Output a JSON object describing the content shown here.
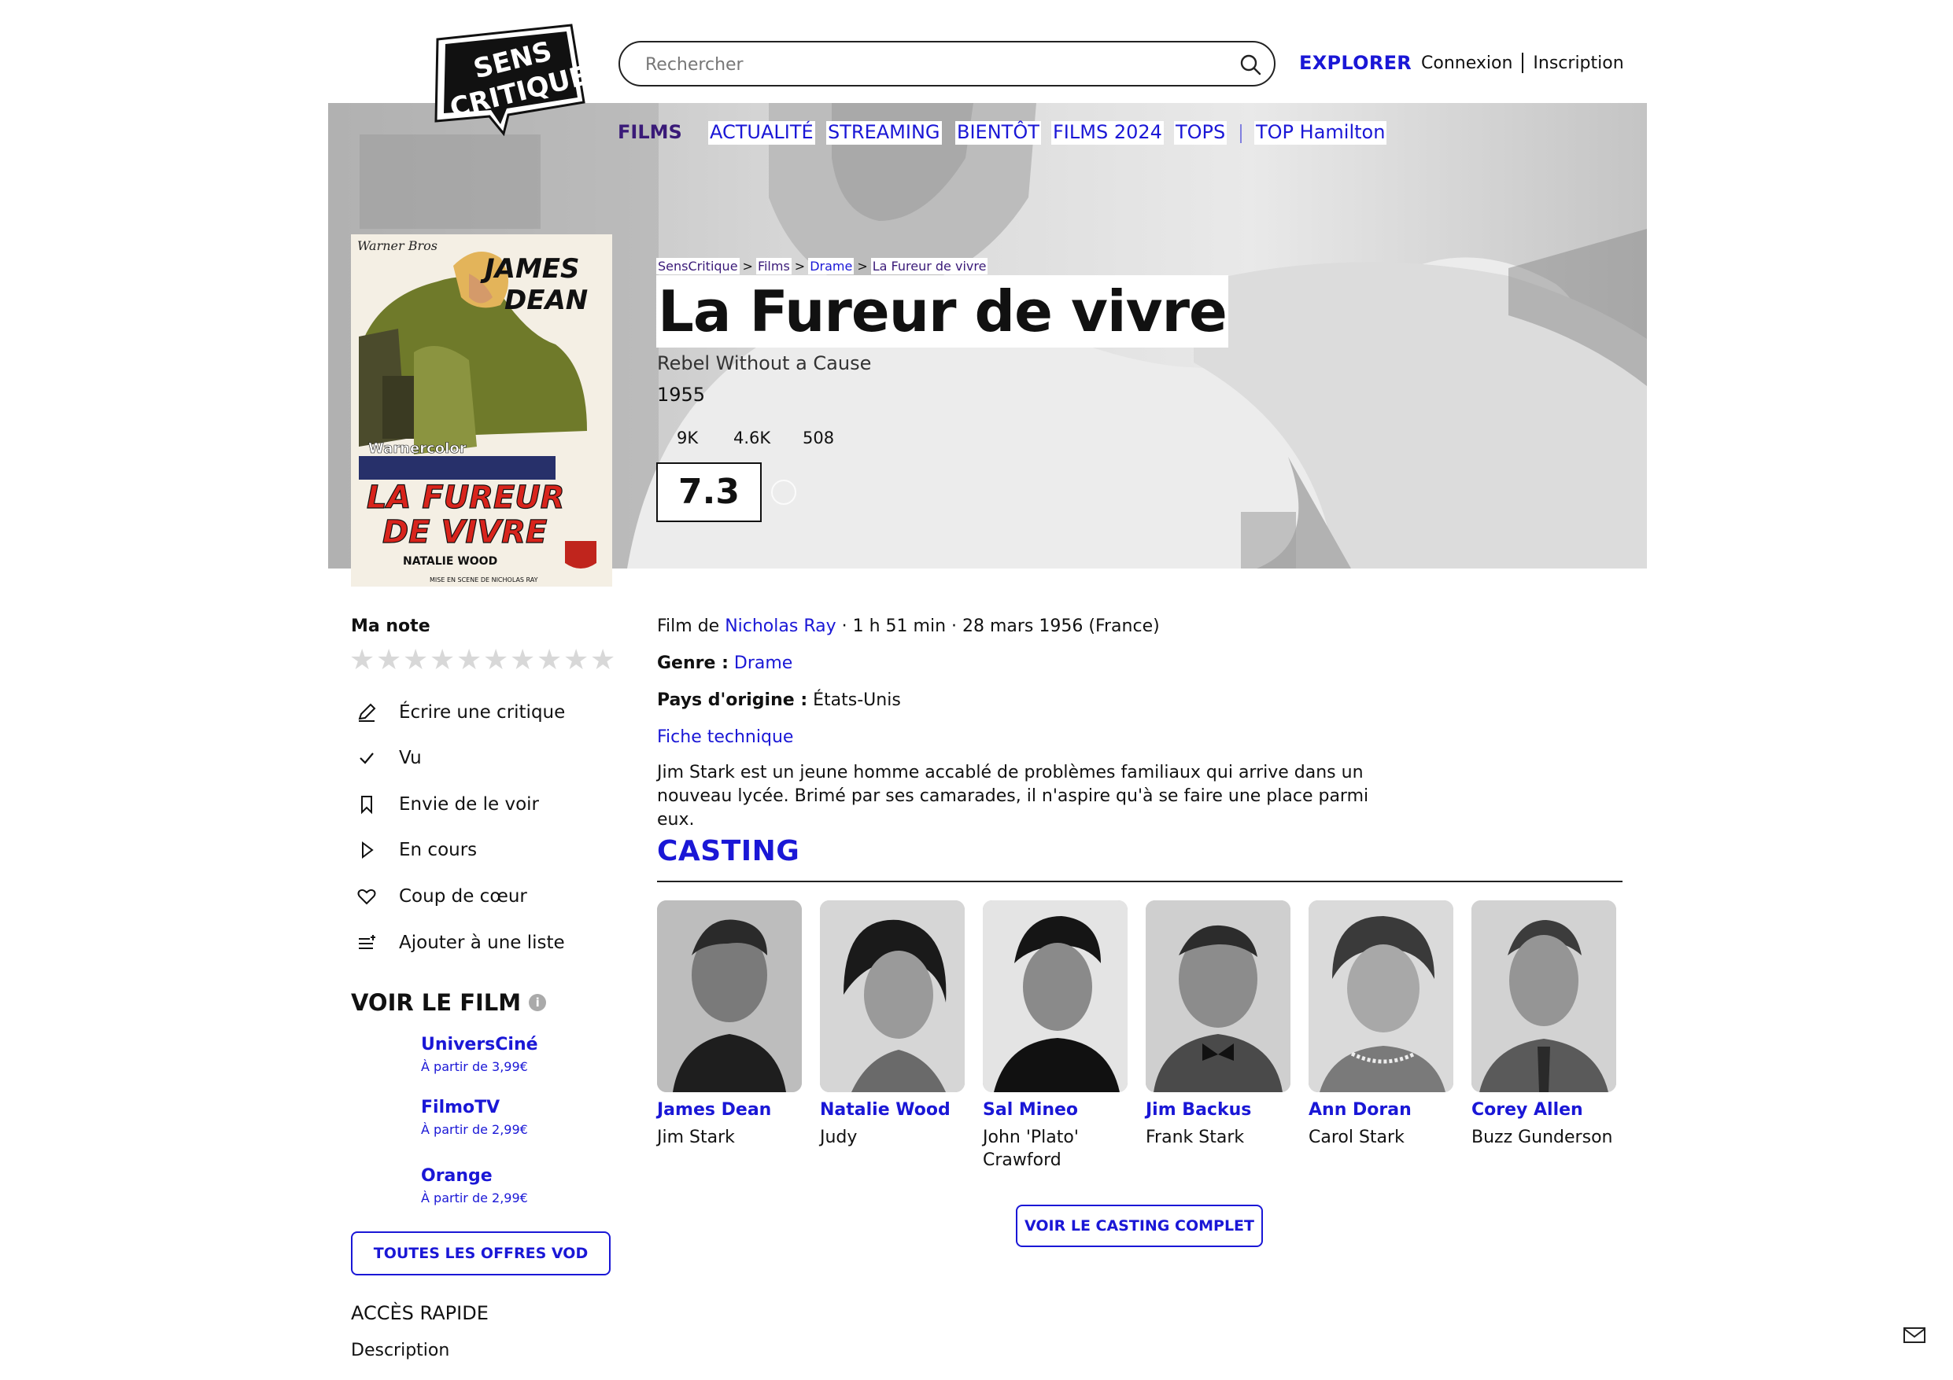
{
  "header": {
    "logo_text": "SENS CRITIQUE",
    "search_placeholder": "Rechercher",
    "explore": "EXPLORER",
    "login": "Connexion",
    "signup": "Inscription"
  },
  "nav": {
    "films": "FILMS",
    "actualite": "ACTUALITÉ",
    "streaming": "STREAMING",
    "bientot": "BIENTÔT",
    "films2024": "FILMS 2024",
    "tops": "TOPS",
    "top_user": "TOP Hamilton"
  },
  "poster": {
    "studio": "Warner Bros",
    "star": "JAMES DEAN",
    "process": "Warnercolor",
    "title_line1": "LA FUREUR",
    "title_line2": "DE VIVRE",
    "credit": "NATALIE WOOD",
    "director_line": "MISE EN SCENE DE NICHOLAS RAY"
  },
  "breadcrumb": [
    "SensCritique",
    "Films",
    "Drame",
    "La Fureur de vivre"
  ],
  "film": {
    "title": "La Fureur de vivre",
    "original_title": "Rebel Without a Cause",
    "year": "1955",
    "stats": [
      "9K",
      "4.6K",
      "508"
    ],
    "score": "7.3",
    "director_prefix": "Film de",
    "director": "Nicholas Ray",
    "details": "· 1 h 51 min · 28 mars 1956 (France)",
    "genre_label": "Genre :",
    "genre": "Drame",
    "country_label": "Pays d'origine :",
    "country": "États-Unis",
    "tech_sheet": "Fiche technique",
    "synopsis": "Jim Stark est un jeune homme accablé de problèmes familiaux qui arrive dans un nouveau lycée. Brimé par ses camarades, il n'aspire qu'à se faire une place parmi eux."
  },
  "sidebar": {
    "my_rating": "Ma note",
    "stars": 10,
    "actions": [
      {
        "label": "Écrire une critique",
        "icon": "pencil-icon"
      },
      {
        "label": "Vu",
        "icon": "check-icon"
      },
      {
        "label": "Envie de le voir",
        "icon": "bookmark-icon"
      },
      {
        "label": "En cours",
        "icon": "play-icon"
      },
      {
        "label": "Coup de cœur",
        "icon": "heart-icon"
      },
      {
        "label": "Ajouter à une liste",
        "icon": "list-add-icon"
      }
    ],
    "watch_title": "VOIR LE FILM",
    "vod": [
      {
        "name": "UniversCiné",
        "price": "À partir de 3,99€"
      },
      {
        "name": "FilmoTV",
        "price": "À partir de 2,99€"
      },
      {
        "name": "Orange",
        "price": "À partir de 2,99€"
      }
    ],
    "all_offers": "TOUTES LES OFFRES VOD",
    "quick_access": "ACCÈS RAPIDE",
    "description": "Description"
  },
  "casting": {
    "title": "CASTING",
    "members": [
      {
        "name": "James Dean",
        "role": "Jim Stark"
      },
      {
        "name": "Natalie Wood",
        "role": "Judy"
      },
      {
        "name": "Sal Mineo",
        "role": "John 'Plato' Crawford"
      },
      {
        "name": "Jim Backus",
        "role": "Frank Stark"
      },
      {
        "name": "Ann Doran",
        "role": "Carol Stark"
      },
      {
        "name": "Corey Allen",
        "role": "Buzz Gunderson"
      }
    ],
    "full_button": "VOIR LE CASTING COMPLET"
  },
  "colors": {
    "accent": "#1a17d6",
    "nav_active": "#3a1a78",
    "text": "#111111"
  }
}
